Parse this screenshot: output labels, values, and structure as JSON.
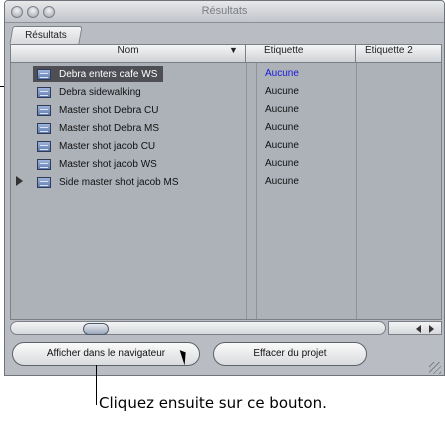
{
  "window": {
    "title": "Résultats"
  },
  "tabs": [
    {
      "label": "Résultats"
    }
  ],
  "columns": {
    "name": "Nom",
    "sort_indicator": "▼",
    "label1": "Étiquette",
    "label2": "Étiquette 2"
  },
  "rows": [
    {
      "name": "Debra enters cafe WS",
      "label": "Aucune",
      "selected": true,
      "label_color": "#1a1ad6"
    },
    {
      "name": "Debra sidewalking",
      "label": "Aucune"
    },
    {
      "name": "Master shot Debra CU",
      "label": "Aucune"
    },
    {
      "name": "Master shot Debra MS",
      "label": "Aucune"
    },
    {
      "name": "Master shot jacob CU",
      "label": "Aucune"
    },
    {
      "name": "Master shot jacob WS",
      "label": "Aucune"
    },
    {
      "name": "Side master shot jacob MS",
      "label": "Aucune",
      "disclosure": true
    }
  ],
  "icons": {
    "clip": "clip-icon",
    "disclosure": "disclosure-triangle-icon",
    "cursor": "cursor-icon"
  },
  "buttons": {
    "show_in_browser": "Afficher dans le navigateur",
    "remove_from_project": "Effacer du projet"
  },
  "callout": {
    "text": "Cliquez ensuite sur ce bouton."
  },
  "colors": {
    "selection": "#4d4f55",
    "accent_label": "#1a1ad6"
  }
}
